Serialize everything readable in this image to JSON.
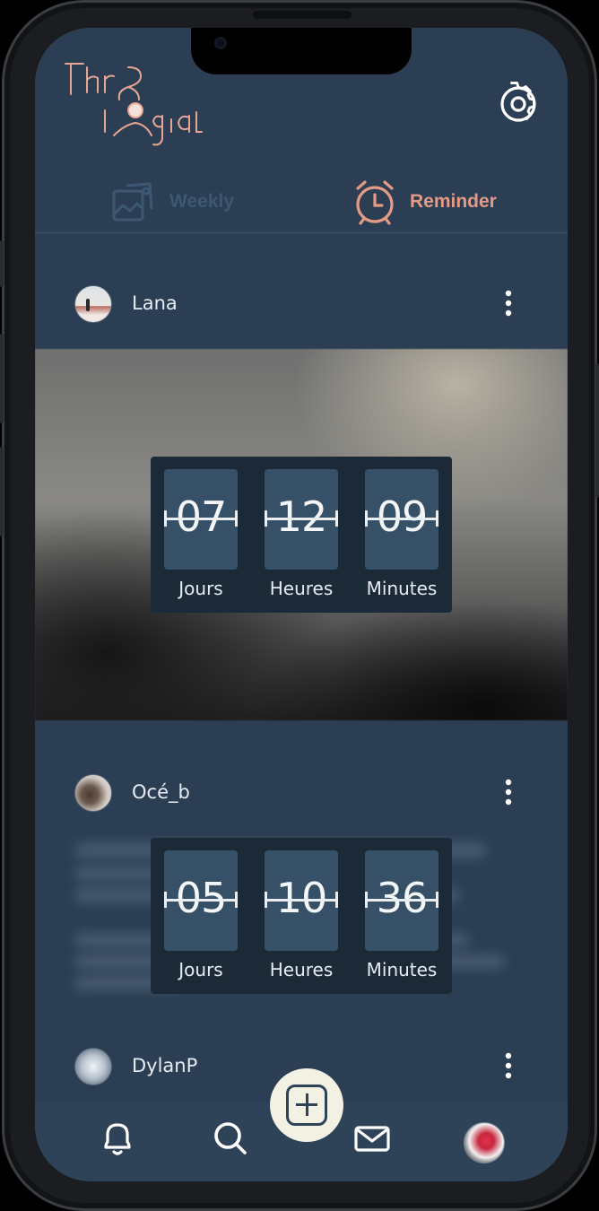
{
  "header": {
    "logo_text": "Chronologia"
  },
  "tabs": [
    {
      "label": "Weekly",
      "active": false,
      "icon": "landscape-photo-icon"
    },
    {
      "label": "Reminder",
      "active": true,
      "icon": "alarm-clock-icon"
    }
  ],
  "posts": [
    {
      "username": "Lana",
      "countdown": {
        "days": "07",
        "hours": "12",
        "minutes": "09"
      }
    },
    {
      "username": "Océ_b",
      "countdown": {
        "days": "05",
        "hours": "10",
        "minutes": "36"
      }
    },
    {
      "username": "DylanP"
    }
  ],
  "countdown_labels": {
    "days": "Jours",
    "hours": "Heures",
    "minutes": "Minutes"
  },
  "nav": {
    "items": [
      "bell-icon",
      "search-icon",
      "add-post-icon",
      "mail-icon",
      "profile-avatar"
    ]
  },
  "colors": {
    "background": "#2b3e53",
    "accent": "#e59a86",
    "inactive": "#3d5873",
    "countdown_bg": "#1c2a38",
    "card": "#365068",
    "fab": "#f3f0e4"
  }
}
